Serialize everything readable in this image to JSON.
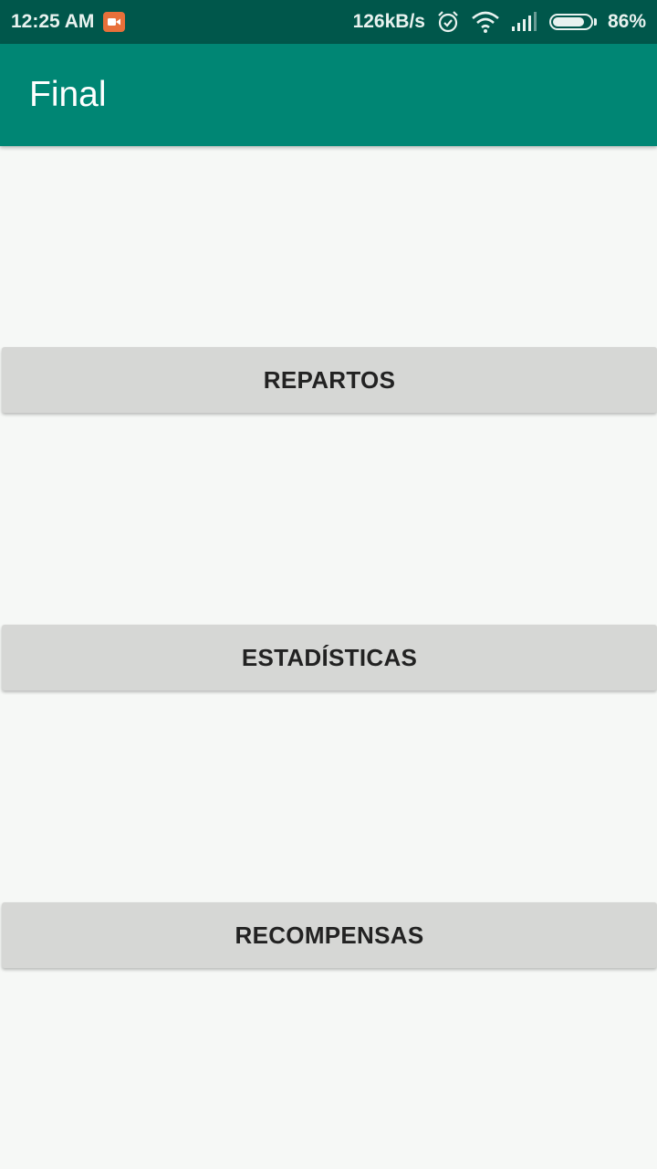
{
  "status_bar": {
    "time": "12:25 AM",
    "network_speed": "126kB/s",
    "battery_percent": "86%",
    "battery_level": 0.86,
    "icons": [
      "screen-record-icon",
      "alarm-icon",
      "wifi-icon",
      "signal-icon",
      "battery-icon"
    ]
  },
  "app_bar": {
    "title": "Final"
  },
  "buttons": [
    {
      "label": "REPARTOS"
    },
    {
      "label": "ESTADÍSTICAS"
    },
    {
      "label": "RECOMPENSAS"
    }
  ],
  "colors": {
    "status_bar": "#00574b",
    "app_bar": "#008674",
    "background": "#f6f8f6",
    "button": "#d6d7d5",
    "record_icon": "#e8703a"
  }
}
